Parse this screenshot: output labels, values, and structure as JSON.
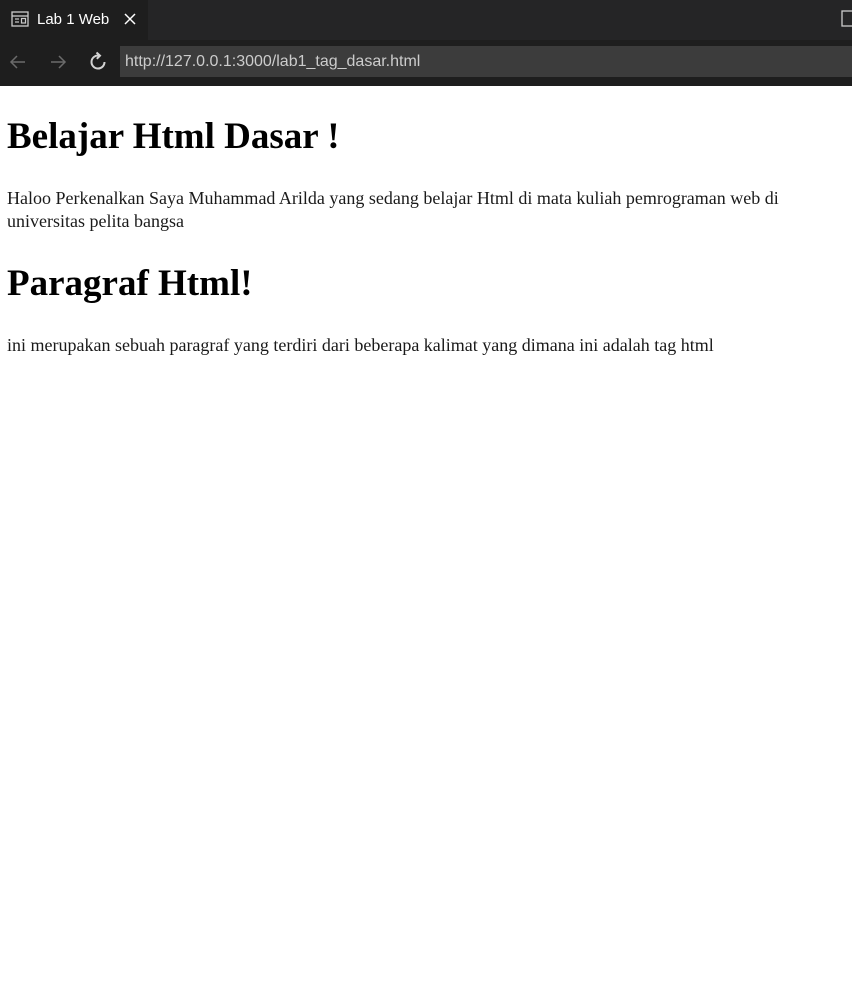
{
  "tab": {
    "title": "Lab 1 Web",
    "close_glyph": "✕"
  },
  "nav": {
    "back_glyph": "←",
    "forward_glyph": "→",
    "reload_glyph": "↻",
    "url": "http://127.0.0.1:3000/lab1_tag_dasar.html"
  },
  "page": {
    "heading1": "Belajar Html Dasar !",
    "paragraph1_line1": "Haloo Perkenalkan Saya Muhammad Arilda yang sedang belajar Html di mata kuliah pemrograman web di",
    "paragraph1_line2": "universitas pelita bangsa",
    "heading2": "Paragraf Html!",
    "paragraph2": "ini merupakan sebuah paragraf yang terdiri dari beberapa kalimat yang dimana ini adalah tag html"
  },
  "colors": {
    "tabbar_bg": "#252526",
    "active_tab_bg": "#1e1e1e",
    "url_field_bg": "#3c3c3c",
    "url_text": "#cccccc",
    "page_bg": "#ffffff"
  }
}
